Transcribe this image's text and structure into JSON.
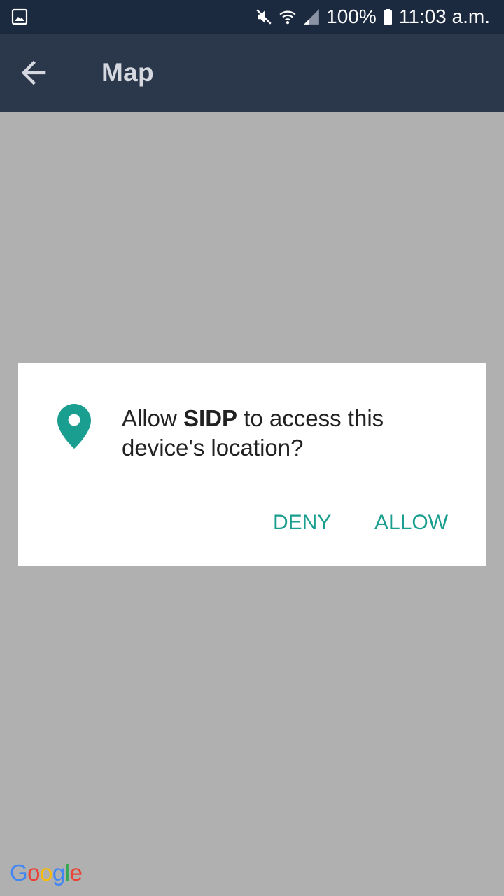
{
  "status_bar": {
    "battery_text": "100%",
    "time": "11:03 a.m.",
    "icons": [
      "gallery-notification-icon",
      "mute-icon",
      "wifi-icon",
      "signal-icon",
      "battery-icon"
    ]
  },
  "toolbar": {
    "title": "Map",
    "back_icon": "arrow-back-icon"
  },
  "dialog": {
    "message_prefix": "Allow ",
    "app_name": "SIDP",
    "message_suffix": " to access this device's location?",
    "icon": "location-pin-icon",
    "deny_label": "DENY",
    "allow_label": "ALLOW"
  },
  "map": {
    "attribution_logo": {
      "letters": [
        "G",
        "o",
        "o",
        "g",
        "l",
        "e"
      ],
      "colors": [
        "#4285F4",
        "#EA4335",
        "#FBBC05",
        "#4285F4",
        "#34A853",
        "#EA4335"
      ]
    }
  },
  "colors": {
    "status_bar_bg": "#1c2a40",
    "toolbar_bg": "#2b374b",
    "accent": "#1a9e8f",
    "scrim": "#b0b0b0"
  }
}
